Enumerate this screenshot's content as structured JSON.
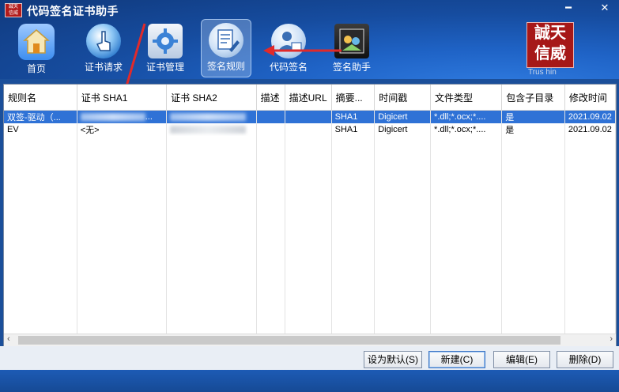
{
  "window": {
    "title": "代码签名证书助手",
    "logo_text": "誠天\n信威",
    "controls": {
      "min": "━",
      "close": "✕"
    }
  },
  "nav": [
    {
      "key": "home",
      "label": "首页",
      "icon": "home-icon",
      "active": false
    },
    {
      "key": "request",
      "label": "证书请求",
      "icon": "hand-pointer-icon",
      "active": false
    },
    {
      "key": "manage",
      "label": "证书管理",
      "icon": "gear-icon",
      "active": false
    },
    {
      "key": "rules",
      "label": "签名规则",
      "icon": "document-pen-icon",
      "active": true
    },
    {
      "key": "sign",
      "label": "代码签名",
      "icon": "user-cert-icon",
      "active": false
    },
    {
      "key": "assistant",
      "label": "签名助手",
      "icon": "assistant-icon",
      "active": false
    }
  ],
  "brand": {
    "line1": "誠天",
    "line2": "信威",
    "sub": "Trus   hin"
  },
  "table": {
    "columns": [
      "规则名",
      "证书 SHA1",
      "证书 SHA2",
      "描述",
      "描述URL",
      "摘要...",
      "时间戳",
      "文件类型",
      "包含子目录",
      "修改时间"
    ],
    "rows": [
      {
        "name": "双签-驱动（...",
        "sha1": "...",
        "sha2": "",
        "desc": "",
        "desc_url": "",
        "digest": "SHA1",
        "timestamp": "Digicert",
        "file_types": "*.dll;*.ocx;*....",
        "subdirs": "是",
        "modified": "2021.09.02",
        "selected": true
      },
      {
        "name": "EV",
        "sha1": "<无>",
        "sha2": "",
        "desc": "",
        "desc_url": "",
        "digest": "SHA1",
        "timestamp": "Digicert",
        "file_types": "*.dll;*.ocx;*....",
        "subdirs": "是",
        "modified": "2021.09.02",
        "selected": false
      }
    ]
  },
  "buttons": {
    "set_default": "设为默认(S)",
    "new": "新建(C)",
    "edit": "编辑(E)",
    "delete": "删除(D)"
  },
  "scroll": {
    "left": "‹",
    "right": "›"
  },
  "colors": {
    "accent": "#2f72d6",
    "title_bg": "#164c9f",
    "brand_red": "#a61818"
  }
}
